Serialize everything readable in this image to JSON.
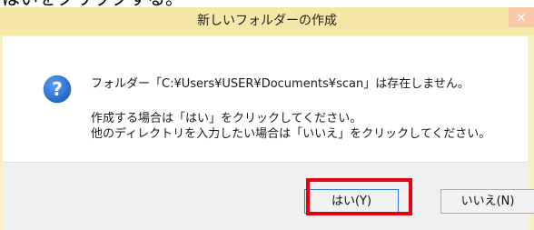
{
  "caption": {
    "text": "はいをクリックする。"
  },
  "dialog": {
    "title": "新しいフォルダーの作成",
    "close_label": "×",
    "message": {
      "line1": "フォルダー「C:¥Users¥USER¥Documents¥scan」は存在しません。",
      "line2": "作成する場合は「はい」をクリックしてください。",
      "line3": "他のディレクトリを入力したい場合は「いいえ」をクリックしてください。"
    },
    "buttons": {
      "yes_label": "はい(Y)",
      "no_label": "いいえ(N)"
    }
  },
  "colors": {
    "title_bar": "#f5e7a8",
    "close_button": "#f9c9aa",
    "highlight_border": "#e60012",
    "icon_fill": "#1c5fbf"
  },
  "icons": {
    "message_icon": "question-icon"
  }
}
